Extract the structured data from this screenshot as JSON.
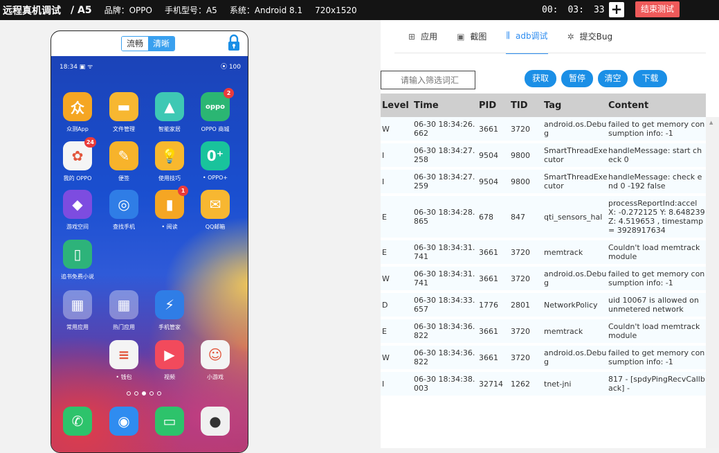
{
  "topbar": {
    "title": "远程真机调试",
    "model": "/ A5",
    "brand": "品牌：OPPO",
    "phone_model": "手机型号：A5",
    "system": "系统：Android 8.1",
    "resolution": "720x1520",
    "timer": {
      "h": "00:",
      "m": "03:",
      "s": "33"
    },
    "plus_label": "+",
    "end_label": "结束测试"
  },
  "phone": {
    "quality_smooth": "流畅",
    "quality_clear": "清晰",
    "status_time": "18:34 ▣ ᯤ",
    "status_right": "⦿ 100",
    "apps": [
      {
        "label": "众测App",
        "glyph": "众",
        "color": "#f5a623"
      },
      {
        "label": "文件管理",
        "glyph": "▬",
        "color": "#f7b731"
      },
      {
        "label": "智能家居",
        "glyph": "▲",
        "color": "#3ec8b4"
      },
      {
        "label": "OPPO 商城",
        "glyph": "oppo",
        "color": "#2bb673",
        "badge": "2"
      },
      {
        "label": "我的 OPPO",
        "glyph": "✿",
        "color": "#f5f5f5",
        "badge": "24"
      },
      {
        "label": "便签",
        "glyph": "✎",
        "color": "#f7b32b"
      },
      {
        "label": "使用技巧",
        "glyph": "💡",
        "color": "#f8b82e"
      },
      {
        "label": "• OPPO+",
        "glyph": "0⁺",
        "color": "#19c39c"
      },
      {
        "label": "游戏空间",
        "glyph": "◆",
        "color": "#7d4ce0"
      },
      {
        "label": "查找手机",
        "glyph": "◎",
        "color": "#2f7de6"
      },
      {
        "label": "• 阅读",
        "glyph": "▮",
        "color": "#f5a623",
        "badge": "1"
      },
      {
        "label": "QQ邮箱",
        "glyph": "✉",
        "color": "#f7b731"
      },
      {
        "label": "追书免费小说",
        "glyph": "▯",
        "color": "#2db37a"
      },
      {
        "label": "常用应用",
        "glyph": "▦",
        "color": "rgba(255,255,255,0.35)"
      },
      {
        "label": "热门应用",
        "glyph": "▦",
        "color": "rgba(255,255,255,0.35)"
      },
      {
        "label": "手机管家",
        "glyph": "⚡",
        "color": "#2f7de6"
      },
      {
        "label": "• 钱包",
        "glyph": "≡",
        "color": "#f4f4f4"
      },
      {
        "label": "视频",
        "glyph": "▶",
        "color": "#f24a5c"
      },
      {
        "label": "小游戏",
        "glyph": "☺",
        "color": "#f4f4f4"
      }
    ],
    "dock": [
      {
        "name": "phone",
        "glyph": "✆",
        "color": "#2dc36b"
      },
      {
        "name": "browser",
        "glyph": "◉",
        "color": "#2f8cf0"
      },
      {
        "name": "messages",
        "glyph": "▭",
        "color": "#2dc36b"
      },
      {
        "name": "camera",
        "glyph": "●",
        "color": "#f0f0f0"
      }
    ]
  },
  "panel": {
    "tabs": [
      {
        "icon": "⊞",
        "label": "应用"
      },
      {
        "icon": "▣",
        "label": "截图"
      },
      {
        "icon": "⫼",
        "label": "adb调试"
      },
      {
        "icon": "✲",
        "label": "提交Bug"
      }
    ],
    "filter_placeholder": "请输入筛选词汇",
    "buttons": {
      "fetch": "获取",
      "pause": "暂停",
      "clear": "清空",
      "download": "下载"
    },
    "columns": {
      "level": "Level",
      "time": "Time",
      "pid": "PID",
      "tid": "TID",
      "tag": "Tag",
      "content": "Content"
    },
    "rows": [
      {
        "level": "W",
        "time": "06-30 18:34:26.662",
        "pid": "3661",
        "tid": "3720",
        "tag": "android.os.Debug",
        "content": "failed to get memory consumption info: -1"
      },
      {
        "level": "I",
        "time": "06-30 18:34:27.258",
        "pid": "9504",
        "tid": "9800",
        "tag": "SmartThreadExecutor",
        "content": "handleMessage: start check 0"
      },
      {
        "level": "I",
        "time": "06-30 18:34:27.259",
        "pid": "9504",
        "tid": "9800",
        "tag": "SmartThreadExecutor",
        "content": "handleMessage: check end 0 -192 false"
      },
      {
        "level": "E",
        "time": "06-30 18:34:28.865",
        "pid": "678",
        "tid": "847",
        "tag": "qti_sensors_hal",
        "content": "processReportInd:accel X: -0.272125 Y: 8.648239 Z: 4.519653 , timestamp = 3928917634"
      },
      {
        "level": "E",
        "time": "06-30 18:34:31.741",
        "pid": "3661",
        "tid": "3720",
        "tag": "memtrack",
        "content": "Couldn't load memtrack module"
      },
      {
        "level": "W",
        "time": "06-30 18:34:31.741",
        "pid": "3661",
        "tid": "3720",
        "tag": "android.os.Debug",
        "content": "failed to get memory consumption info: -1"
      },
      {
        "level": "D",
        "time": "06-30 18:34:33.657",
        "pid": "1776",
        "tid": "2801",
        "tag": "NetworkPolicy",
        "content": "uid 10067 is allowed on unmetered network"
      },
      {
        "level": "E",
        "time": "06-30 18:34:36.822",
        "pid": "3661",
        "tid": "3720",
        "tag": "memtrack",
        "content": "Couldn't load memtrack module"
      },
      {
        "level": "W",
        "time": "06-30 18:34:36.822",
        "pid": "3661",
        "tid": "3720",
        "tag": "android.os.Debug",
        "content": "failed to get memory consumption info: -1"
      },
      {
        "level": "I",
        "time": "06-30 18:34:38.003",
        "pid": "32714",
        "tid": "1262",
        "tag": "tnet-jni",
        "content": "817 - [spdyPingRecvCallback] -"
      }
    ]
  }
}
